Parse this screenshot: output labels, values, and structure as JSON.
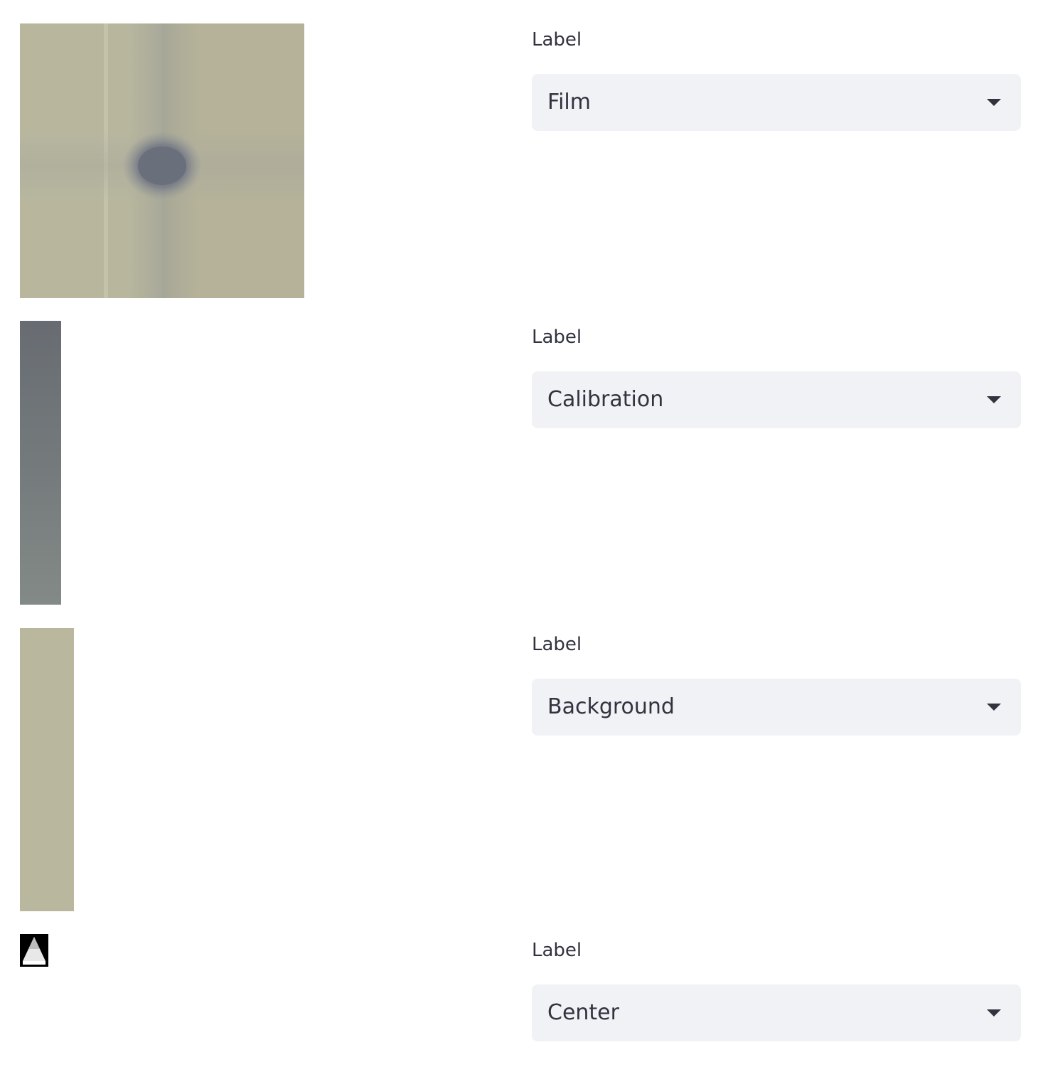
{
  "rows": [
    {
      "image": {
        "name": "film-image",
        "colors": {
          "base": "#b6b399",
          "spot": "#6f7580"
        }
      },
      "field": {
        "label": "Label",
        "selected": "Film"
      }
    },
    {
      "image": {
        "name": "calibration-image",
        "colors": {
          "top": "#6a6e74",
          "bottom": "#808884"
        }
      },
      "field": {
        "label": "Label",
        "selected": "Calibration"
      }
    },
    {
      "image": {
        "name": "background-image",
        "colors": {
          "base": "#b6b399"
        }
      },
      "field": {
        "label": "Label",
        "selected": "Background"
      }
    },
    {
      "image": {
        "name": "center-image",
        "colors": {
          "frame": "#000000",
          "fill": "#ffffff"
        }
      },
      "field": {
        "label": "Label",
        "selected": "Center"
      }
    }
  ]
}
